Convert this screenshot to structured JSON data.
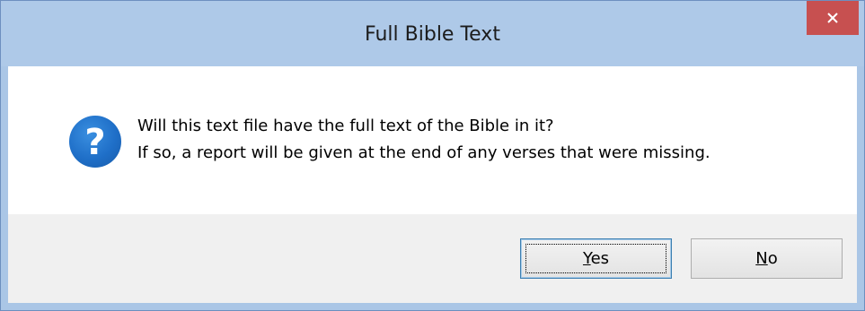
{
  "window": {
    "title": "Full Bible Text",
    "close_symbol": "×"
  },
  "message": {
    "icon": "question-icon",
    "icon_glyph": "?",
    "line1": "Will this text file have the full text of the Bible in it?",
    "line2": "If so, a report will be given at the end of any verses that were missing."
  },
  "buttons": {
    "yes": {
      "accelerator": "Y",
      "rest": "es",
      "is_default": true
    },
    "no": {
      "accelerator": "N",
      "rest": "o",
      "is_default": false
    }
  },
  "colors": {
    "titlebar": "#aec9e8",
    "close_button": "#c75050",
    "icon_blue": "#1f6fc8",
    "button_area": "#f0f0f0"
  }
}
